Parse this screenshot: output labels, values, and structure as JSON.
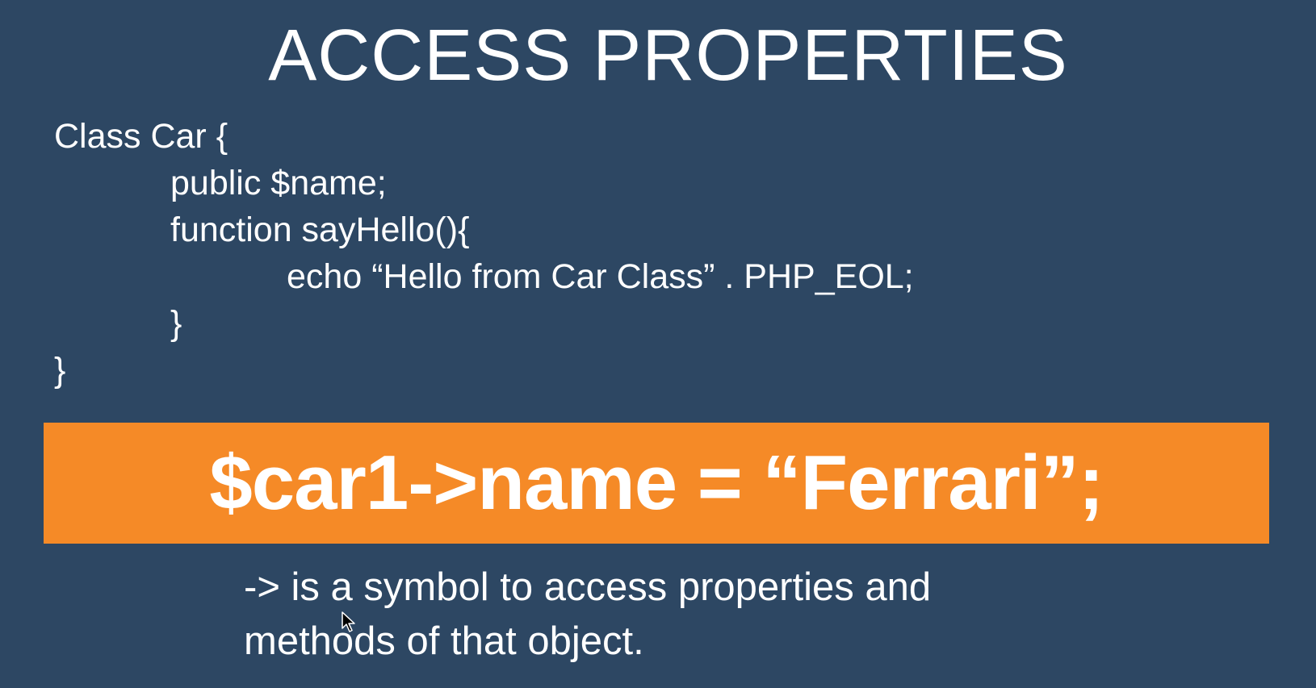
{
  "slide": {
    "title": "ACCESS PROPERTIES",
    "code_lines": [
      "Class Car {",
      "public $name;",
      "function sayHello(){",
      "echo “Hello from Car Class” . PHP_EOL;",
      "}",
      "}"
    ],
    "highlight": "$car1->name = “Ferrari”;",
    "note_lines": [
      "-> is a symbol to access properties and",
      "methods of that object."
    ]
  },
  "colors": {
    "background": "#2d4763",
    "accent": "#f58a27",
    "text": "#ffffff"
  },
  "icons": {
    "cursor": "mouse-pointer-icon"
  }
}
